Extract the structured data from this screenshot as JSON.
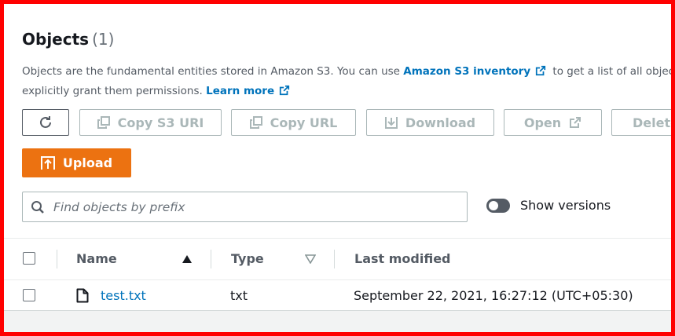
{
  "header": {
    "title": "Objects",
    "count": "(1)"
  },
  "description": {
    "part1": "Objects are the fundamental entities stored in Amazon S3. You can use ",
    "inventory_link": "Amazon S3 inventory",
    "part2": " to get a list of all objects in your bucket.",
    "line2": "explicitly grant them permissions. ",
    "learn_more": "Learn more"
  },
  "toolbar": {
    "copy_s3_uri": "Copy S3 URI",
    "copy_url": "Copy URL",
    "download": "Download",
    "open": "Open",
    "delete": "Delete",
    "upload": "Upload"
  },
  "search": {
    "placeholder": "Find objects by prefix",
    "value": ""
  },
  "versions_toggle": {
    "label": "Show versions",
    "on": false
  },
  "table": {
    "columns": [
      "Name",
      "Type",
      "Last modified"
    ],
    "rows": [
      {
        "name": "test.txt",
        "type": "txt",
        "last_modified": "September 22, 2021, 16:27:12 (UTC+05:30)"
      }
    ]
  },
  "colors": {
    "accent": "#ec7211",
    "link": "#0073bb",
    "border": "#ff0000"
  },
  "icons": {
    "refresh": "refresh-icon",
    "copy": "copy-icon",
    "download": "download-icon",
    "external": "external-link-icon",
    "upload": "upload-icon",
    "search": "search-icon",
    "file": "file-icon",
    "sort_asc": "sort-ascending-icon",
    "sort_desc": "sort-descending-icon"
  }
}
